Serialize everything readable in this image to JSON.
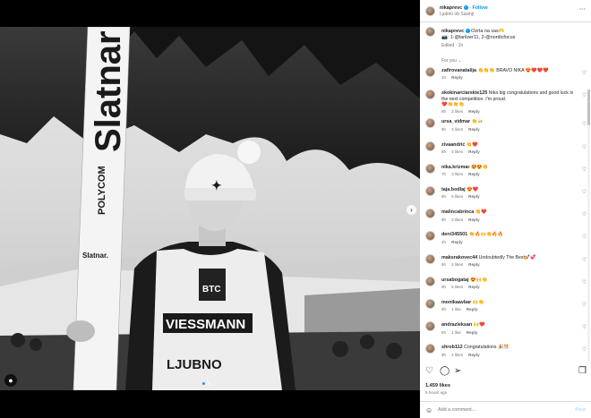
{
  "post": {
    "username": "nikaprevc",
    "follow_label": "Follow",
    "location": "Ljubno ob Savinji",
    "caption_user": "nikaprevc",
    "caption_text": "Ozrta na vas🫶",
    "caption_line2": "📷: 1-@larilzer11, 2-@nordicfocus",
    "caption_edited": "Edited · 1h",
    "for_you": "For you",
    "more_label": "···"
  },
  "comments": [
    {
      "user": "zafirovanatalija",
      "text": "👏👏👏 BRAVO NIKA 😍❤️❤️❤️",
      "time": "1h",
      "likes": "",
      "reply": "Reply"
    },
    {
      "user": "skokinarciarskie125",
      "text": "Nika big congratulations and good luck in the next competition. I'm proud.",
      "extra": "❤️👏👏👏",
      "time": "8h",
      "likes": "3 likes",
      "reply": "Reply"
    },
    {
      "user": "ursa_vidmar",
      "text": "👏🍻",
      "time": "8h",
      "likes": "3 likes",
      "reply": "Reply"
    },
    {
      "user": "zivaandric",
      "text": "👏❤️",
      "time": "8h",
      "likes": "4 likes",
      "reply": "Reply"
    },
    {
      "user": "nika.krizmar",
      "text": "😍😍👏",
      "time": "7h",
      "likes": "3 likes",
      "reply": "Reply"
    },
    {
      "user": "taja.bodlaj",
      "text": "😍❤️",
      "time": "9h",
      "likes": "5 likes",
      "reply": "Reply"
    },
    {
      "user": "malincabrinca",
      "text": "👏❤️",
      "time": "9h",
      "likes": "3 likes",
      "reply": "Reply"
    },
    {
      "user": "deni345501",
      "text": "👏🔥🙌👏🔥🔥",
      "time": "4h",
      "likes": "",
      "reply": "Reply"
    },
    {
      "user": "maksrakovec44",
      "text": "Undoubtedly The Best💅💞",
      "time": "9h",
      "likes": "2 likes",
      "reply": "Reply"
    },
    {
      "user": "ursabogataj",
      "text": "😍🙌👏",
      "time": "8h",
      "likes": "5 likes",
      "reply": "Reply"
    },
    {
      "user": "monikaavbar",
      "text": "🙌👏",
      "time": "9h",
      "likes": "1 like",
      "reply": "Reply"
    },
    {
      "user": "andrazleksan",
      "text": "🙌❤️",
      "time": "5h",
      "likes": "1 like",
      "reply": "Reply"
    },
    {
      "user": "shrob112",
      "text": "Congratulations 🎉🎊",
      "time": "9h",
      "likes": "2 likes",
      "reply": "Reply"
    }
  ],
  "footer": {
    "likes": "1,459 likes",
    "ago": "9 hours ago",
    "add_comment_placeholder": "Add a comment...",
    "post_label": "Post"
  },
  "photo": {
    "ski_brand": "Slatnar",
    "ski_sponsor": "POLYCOM",
    "bib_sponsor": "VIESSMANN",
    "bib_city": "LJUBNO",
    "bib_top": "BTC"
  },
  "colors": {
    "accent": "#0095f6",
    "text": "#262626",
    "muted": "#737373"
  }
}
